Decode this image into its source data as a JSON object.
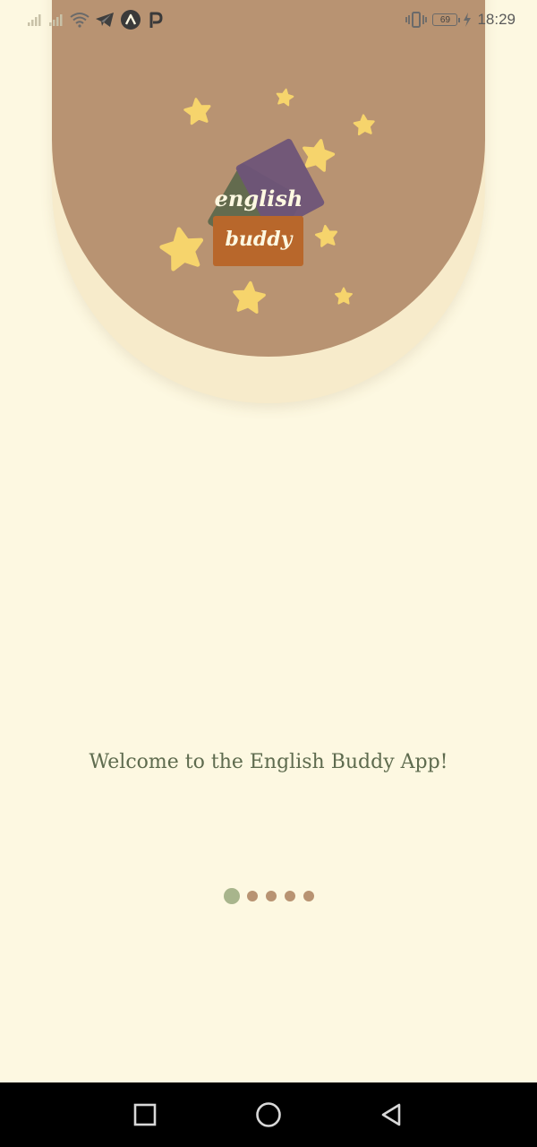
{
  "status_bar": {
    "time": "18:29",
    "battery": "69",
    "left_icons": [
      "signal-icon",
      "signal-icon",
      "wifi-icon",
      "telegram-icon",
      "arc-app-icon",
      "parking-app-icon"
    ],
    "right_icons": [
      "vibrate-icon",
      "battery-icon",
      "charging-icon"
    ]
  },
  "logo": {
    "line1": "english",
    "line2": "buddy",
    "colors": {
      "purple": "#6e5478",
      "green": "#636b4e",
      "orange": "#b8672b",
      "star": "#f6d46c"
    }
  },
  "welcome_text": "Welcome to the English Buddy App!",
  "pager": {
    "count": 5,
    "active_index": 0
  },
  "nav_bar": [
    "recents-icon",
    "home-icon",
    "back-icon"
  ],
  "colors": {
    "background": "#fdf8e1",
    "hero": "#b89372",
    "hero_shadow_layer": "#f7ebcb",
    "welcome_text": "#5e6b4e",
    "dot_active": "#a8b58c",
    "dot_inactive": "#b89372"
  }
}
